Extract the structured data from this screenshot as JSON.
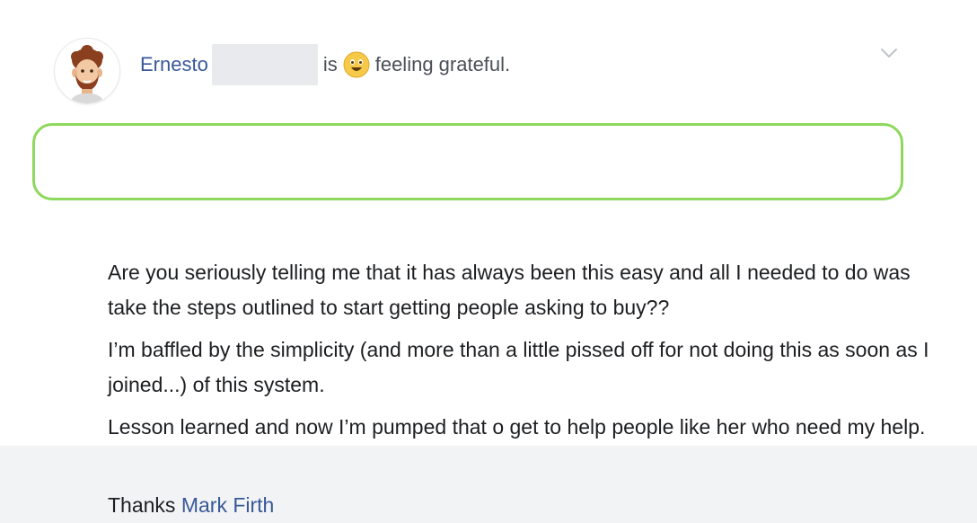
{
  "post": {
    "author_first_name": "Ernesto",
    "verb": "is",
    "feeling": "feeling grateful.",
    "feeling_emoji": "grateful-face-emoji",
    "menu_icon": "chevron-down-icon",
    "paragraphs": [
      "Are you seriously telling me that it has always been this easy and all I needed to do was take the steps outlined to start getting people asking to buy??",
      "I’m baffled by the simplicity (and more than a little pissed off for not doing this as soon as I joined...) of this system.",
      "Lesson learned and now I’m pumped that o get to help people like her who need my help."
    ],
    "closing": {
      "prefix": "Thanks",
      "mention": "Mark Firth"
    },
    "colors": {
      "link": "#385898",
      "highlight": "#8ed85d",
      "text": "#1c1e21",
      "meta_text": "#4b4f56"
    }
  }
}
